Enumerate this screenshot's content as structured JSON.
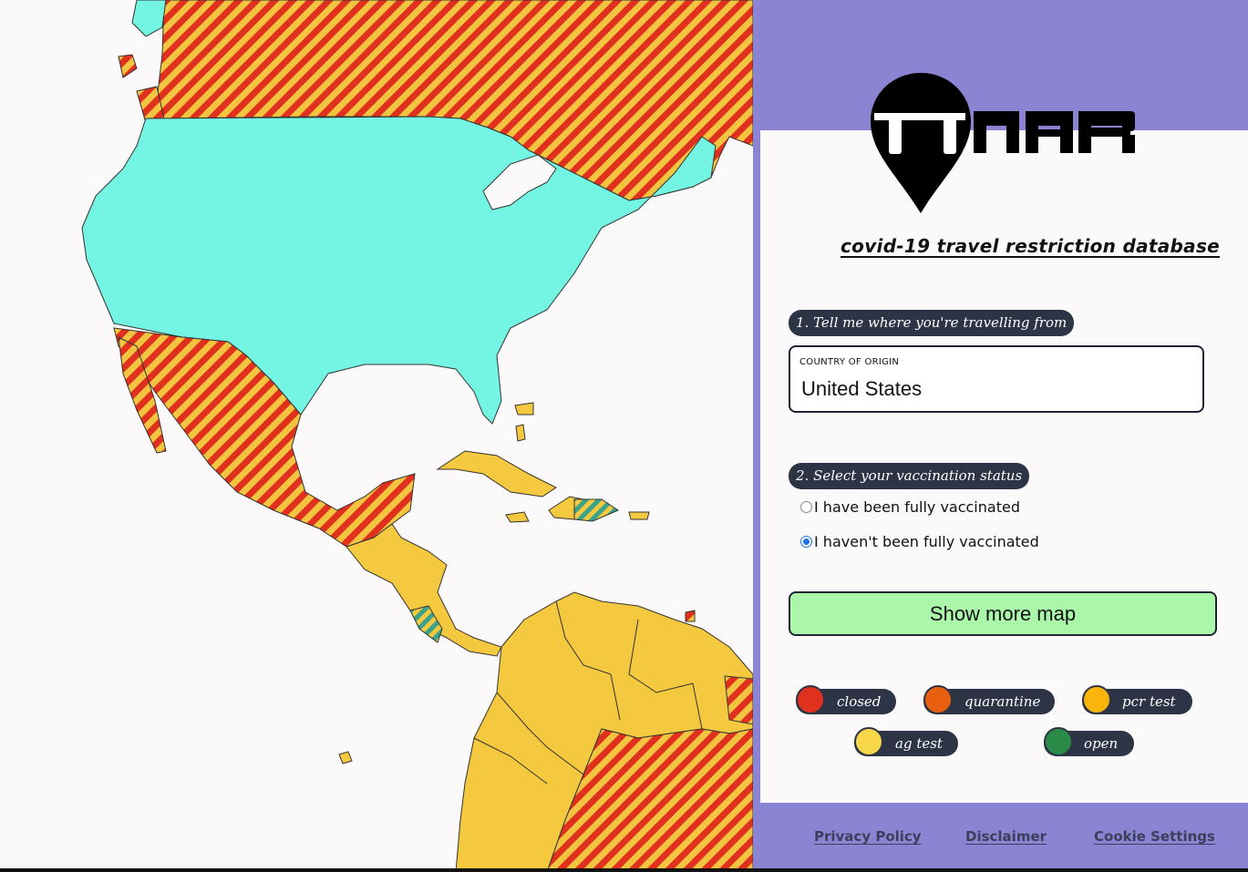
{
  "app": {
    "subtitle": "covid-19 travel restriction database"
  },
  "steps": {
    "origin_prompt": "1. Tell me where you're travelling from",
    "vaccination_prompt": "2. Select your vaccination status"
  },
  "origin": {
    "label": "COUNTRY OF ORIGIN",
    "value": "United States"
  },
  "vaccination": {
    "options": [
      {
        "label": "I have been fully vaccinated",
        "checked": false
      },
      {
        "label": "I haven't been fully vaccinated",
        "checked": true
      }
    ]
  },
  "actions": {
    "show_more_map": "Show more map"
  },
  "legend": [
    {
      "label": "closed",
      "color": "#e0301e"
    },
    {
      "label": "quarantine",
      "color": "#e8600f"
    },
    {
      "label": "pcr test",
      "color": "#fbb50a"
    },
    {
      "label": "ag test",
      "color": "#f7d64a"
    },
    {
      "label": "open",
      "color": "#2a8a48"
    }
  ],
  "footer": {
    "privacy": "Privacy Policy",
    "disclaimer": "Disclaimer",
    "cookies": "Cookie Settings"
  },
  "map_colors": {
    "origin": "#74f4e2",
    "stripe_red": "#e0301e",
    "stripe_yellow": "#f3c43f",
    "ag_test": "#f4c93f",
    "open_stripe": "#3aa38a"
  }
}
